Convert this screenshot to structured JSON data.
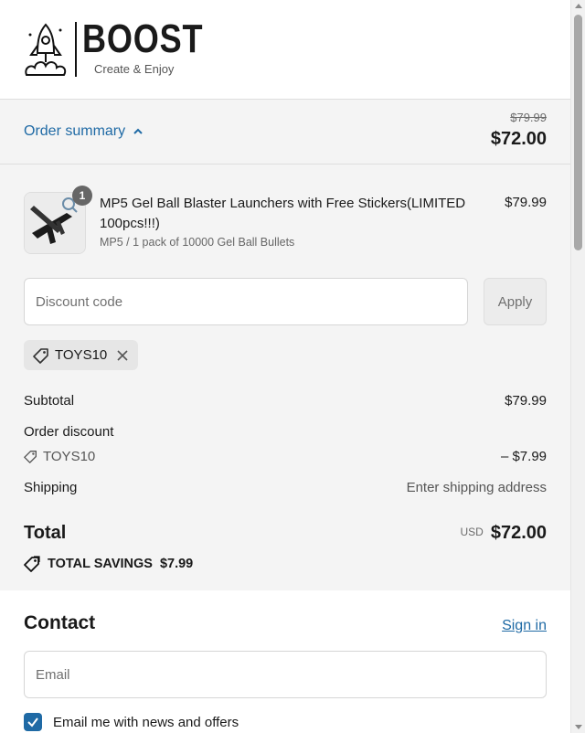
{
  "brand": {
    "name": "BOOST",
    "tagline": "Create & Enjoy"
  },
  "summary_bar": {
    "toggle_label": "Order summary",
    "original_price": "$79.99",
    "current_price": "$72.00"
  },
  "product": {
    "quantity": "1",
    "name": "MP5 Gel Ball Blaster Launchers with Free Stickers(LIMITED 100pcs!!!)",
    "variant": "MP5 / 1 pack of 10000 Gel Ball Bullets",
    "price": "$79.99"
  },
  "discount": {
    "placeholder": "Discount code",
    "apply_label": "Apply",
    "applied_code": "TOYS10"
  },
  "totals": {
    "subtotal_label": "Subtotal",
    "subtotal_value": "$79.99",
    "order_discount_label": "Order discount",
    "discount_code": "TOYS10",
    "discount_value": "– $7.99",
    "shipping_label": "Shipping",
    "shipping_value": "Enter shipping address",
    "total_label": "Total",
    "currency": "USD",
    "total_value": "$72.00",
    "savings_label": "TOTAL SAVINGS",
    "savings_value": "$7.99"
  },
  "contact": {
    "title": "Contact",
    "sign_in": "Sign in",
    "email_placeholder": "Email",
    "newsletter_label": "Email me with news and offers",
    "newsletter_checked": true
  },
  "colors": {
    "accent": "#1f6aa5",
    "summary_bg": "#f4f4f4"
  }
}
